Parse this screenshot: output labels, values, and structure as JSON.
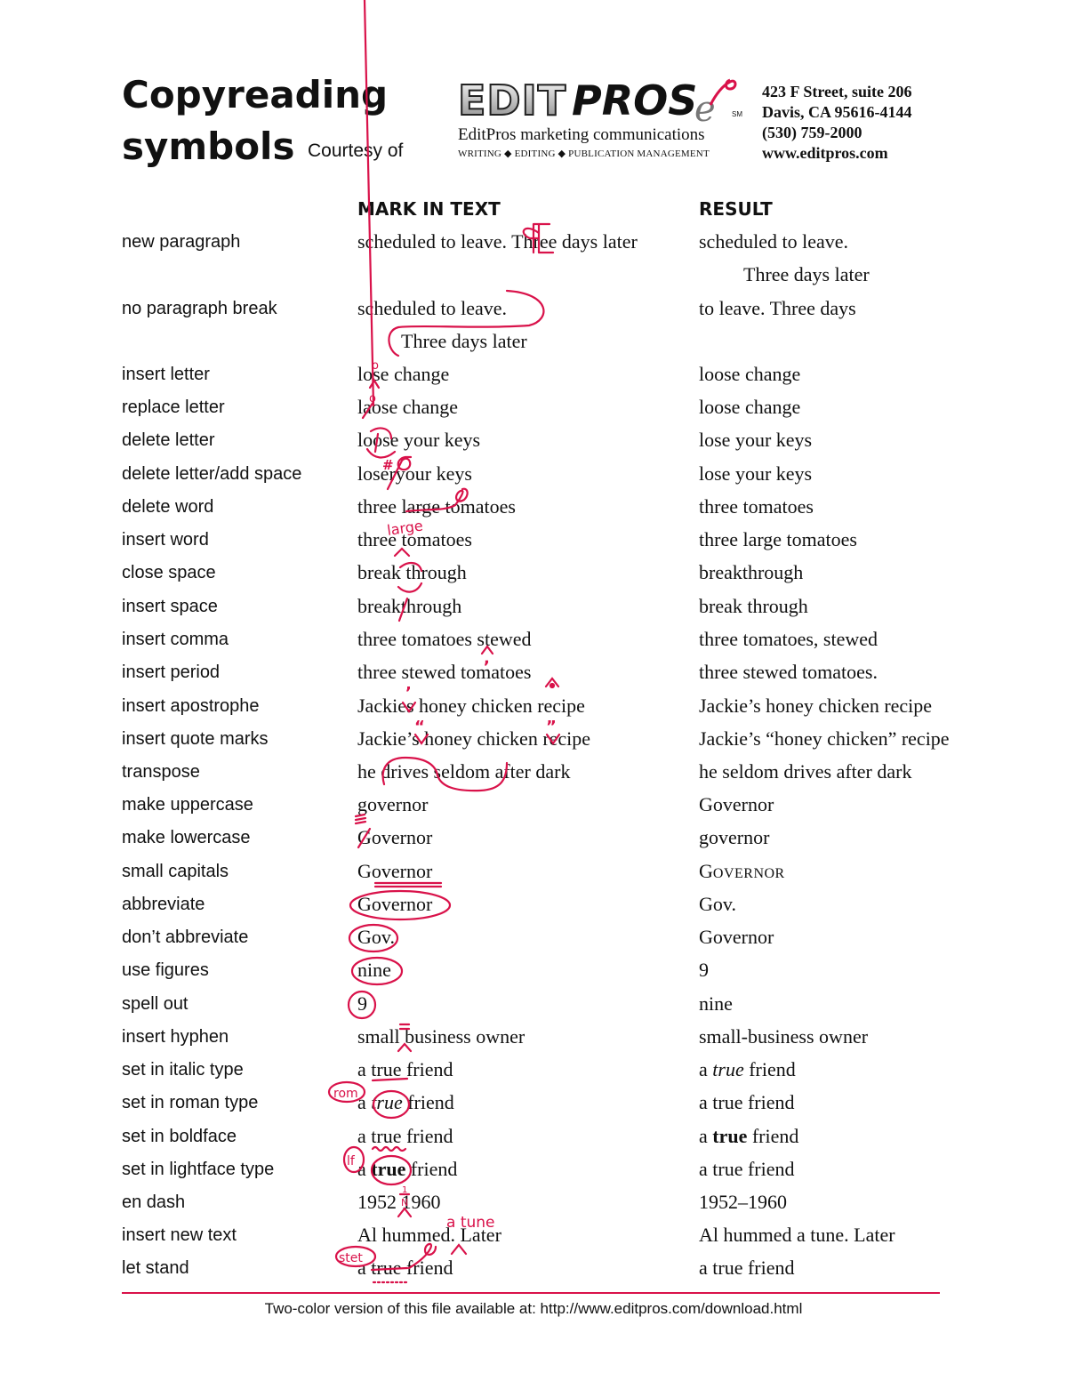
{
  "header": {
    "title_line1": "Copyreading",
    "title_line2": "symbols",
    "courtesy": "Courtesy of",
    "logo": {
      "edit": "EDIT",
      "pros": "PROS",
      "e": "e",
      "sm": "SM",
      "subtitle": "EditPros marketing communications",
      "tagline": "WRITING ◆ EDITING ◆ PUBLICATION MANAGEMENT"
    },
    "address": {
      "street": "423 F Street, suite 206",
      "city": "Davis, CA 95616-4144",
      "phone": "(530) 759-2000",
      "web": "www.editpros.com"
    }
  },
  "columns": {
    "mark": "MARK IN TEXT",
    "result": "RESULT"
  },
  "rows": [
    {
      "label": "new paragraph",
      "mark": "scheduled to leave. Three days later",
      "result": "scheduled to leave.",
      "result2": "Three days later"
    },
    {
      "label": "no paragraph break",
      "mark": "scheduled to leave.",
      "mark2": "Three days later",
      "result": "to leave. Three days"
    },
    {
      "label": "insert letter",
      "mark": "lose change",
      "result": "loose change"
    },
    {
      "label": "replace letter",
      "mark": "laose change",
      "result": "loose change"
    },
    {
      "label": "delete letter",
      "mark": "loose your keys",
      "result": "lose your keys"
    },
    {
      "label": "delete letter/add space",
      "mark": "loseryour keys",
      "result": "lose your keys"
    },
    {
      "label": "delete word",
      "mark": "three large tomatoes",
      "result": "three tomatoes"
    },
    {
      "label": "insert word",
      "mark": "three tomatoes",
      "result": "three large tomatoes"
    },
    {
      "label": "close space",
      "mark": "break through",
      "result": "breakthrough"
    },
    {
      "label": "insert space",
      "mark": "breakthrough",
      "result": "break through"
    },
    {
      "label": "insert comma",
      "mark": "three tomatoes stewed",
      "result": "three tomatoes, stewed"
    },
    {
      "label": "insert period",
      "mark": "three stewed tomatoes",
      "result": "three stewed tomatoes."
    },
    {
      "label": "insert apostrophe",
      "mark": "Jackies honey chicken recipe",
      "result": "Jackie’s honey chicken recipe"
    },
    {
      "label": "insert quote marks",
      "mark": "Jackie’s honey chicken recipe",
      "result": "Jackie’s “honey chicken” recipe"
    },
    {
      "label": "transpose",
      "mark": "he drives seldom after dark",
      "result": "he seldom drives after dark"
    },
    {
      "label": "make uppercase",
      "mark": "governor",
      "result": "Governor"
    },
    {
      "label": "make lowercase",
      "mark": "Governor",
      "result": "governor"
    },
    {
      "label": "small capitals",
      "mark": "Governor",
      "result_first": "G",
      "result_rest": "OVERNOR"
    },
    {
      "label": "abbreviate",
      "mark": "Governor",
      "result": "Gov."
    },
    {
      "label": "don’t abbreviate",
      "mark": "Gov.",
      "result": "Governor"
    },
    {
      "label": "use figures",
      "mark": "nine",
      "result": "9"
    },
    {
      "label": "spell out",
      "mark": "9",
      "result": "nine"
    },
    {
      "label": "insert hyphen",
      "mark": "small business owner",
      "result": "small-business owner"
    },
    {
      "label": "set in italic type",
      "mark_pre": "a ",
      "mark_word": "true",
      "mark_post": " friend",
      "result_pre": "a ",
      "result_word": "true",
      "result_post": " friend"
    },
    {
      "label": "set in roman type",
      "mark_pre": "a ",
      "mark_word": "true",
      "mark_post": " friend",
      "result": "a true friend"
    },
    {
      "label": "set in boldface",
      "mark": "a true friend",
      "result_pre": "a ",
      "result_word": "true",
      "result_post": " friend"
    },
    {
      "label": "set in lightface type",
      "mark_pre": "a ",
      "mark_word": "true",
      "mark_post": " friend",
      "result": "a true friend"
    },
    {
      "label": "en dash",
      "mark": "1952 1960",
      "result": "1952–1960"
    },
    {
      "label": "insert new text",
      "mark": "Al hummed. Later",
      "result": "Al hummed a tune. Later"
    },
    {
      "label": "let stand",
      "mark": "a true friend",
      "result": "a true friend"
    }
  ],
  "annotations": {
    "hash": "#",
    "large": "large",
    "comma": ",",
    "apostrophe": "’",
    "open_quote": "“",
    "close_quote": "”",
    "rom": "rom",
    "lf": "lf",
    "en_n": "N",
    "en_1": "1",
    "a_tune": "a tune",
    "stet": "stet",
    "accent_color": "#d9124a"
  },
  "footer": {
    "text": "Two-color version of this file available at:  http://www.editpros.com/download.html"
  }
}
